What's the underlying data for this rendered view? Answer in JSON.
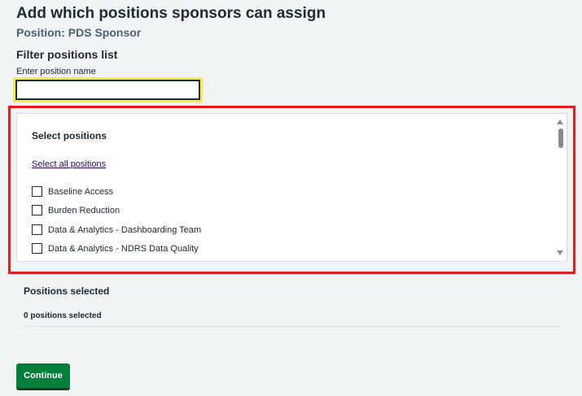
{
  "page": {
    "title": "Add which positions sponsors can assign",
    "subtitle": "Position: PDS Sponsor"
  },
  "filter": {
    "heading": "Filter positions list",
    "label": "Enter position name",
    "value": ""
  },
  "list": {
    "title": "Select positions",
    "select_all": "Select all positions",
    "options": [
      "Baseline Access",
      "Burden Reduction",
      "Data & Analytics - Dashboarding Team",
      "Data & Analytics - NDRS Data Quality"
    ]
  },
  "selected": {
    "heading": "Positions selected",
    "count_text": "0 positions selected"
  },
  "actions": {
    "continue_label": "Continue"
  },
  "colors": {
    "primary_button": "#007f3b",
    "link": "#330072",
    "highlight": "#e01f1f",
    "focus": "#ffeb3b"
  }
}
